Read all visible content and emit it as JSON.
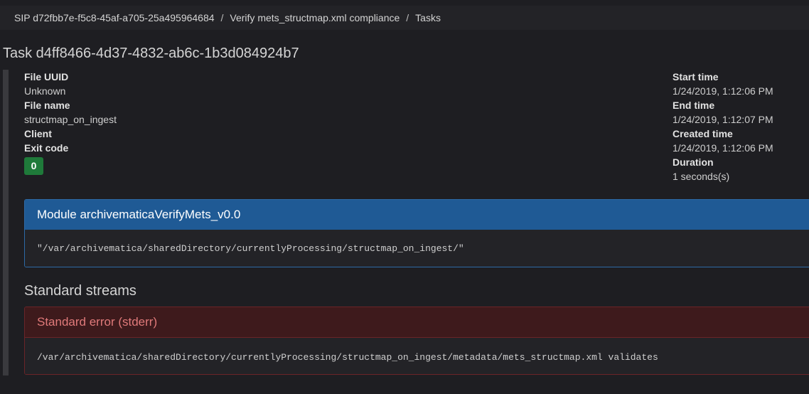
{
  "breadcrumb": {
    "items": [
      "SIP d72fbb7e-f5c8-45af-a705-25a495964684",
      "Verify mets_structmap.xml compliance",
      "Tasks"
    ],
    "separator": "/"
  },
  "task": {
    "title": "Task d4ff8466-4d37-4832-ab6c-1b3d084924b7"
  },
  "meta_left": {
    "file_uuid_label": "File UUID",
    "file_uuid_value": "Unknown",
    "file_name_label": "File name",
    "file_name_value": "structmap_on_ingest",
    "client_label": "Client",
    "exit_code_label": "Exit code",
    "exit_code_value": "0"
  },
  "meta_right": {
    "start_time_label": "Start time",
    "start_time_value": "1/24/2019, 1:12:06 PM",
    "end_time_label": "End time",
    "end_time_value": "1/24/2019, 1:12:07 PM",
    "created_time_label": "Created time",
    "created_time_value": "1/24/2019, 1:12:06 PM",
    "duration_label": "Duration",
    "duration_value": "1 seconds(s)"
  },
  "module_panel": {
    "heading": "Module archivematicaVerifyMets_v0.0",
    "body": "\"/var/archivematica/sharedDirectory/currentlyProcessing/structmap_on_ingest/\""
  },
  "streams": {
    "title": "Standard streams",
    "stderr_heading": "Standard error (stderr)",
    "stderr_body": "/var/archivematica/sharedDirectory/currentlyProcessing/structmap_on_ingest/metadata/mets_structmap.xml validates"
  },
  "colors": {
    "background": "#1e1e22",
    "module_heading": "#1f5a95",
    "stderr_heading": "#3e1a1c",
    "exit_badge": "#1f7a3a"
  }
}
